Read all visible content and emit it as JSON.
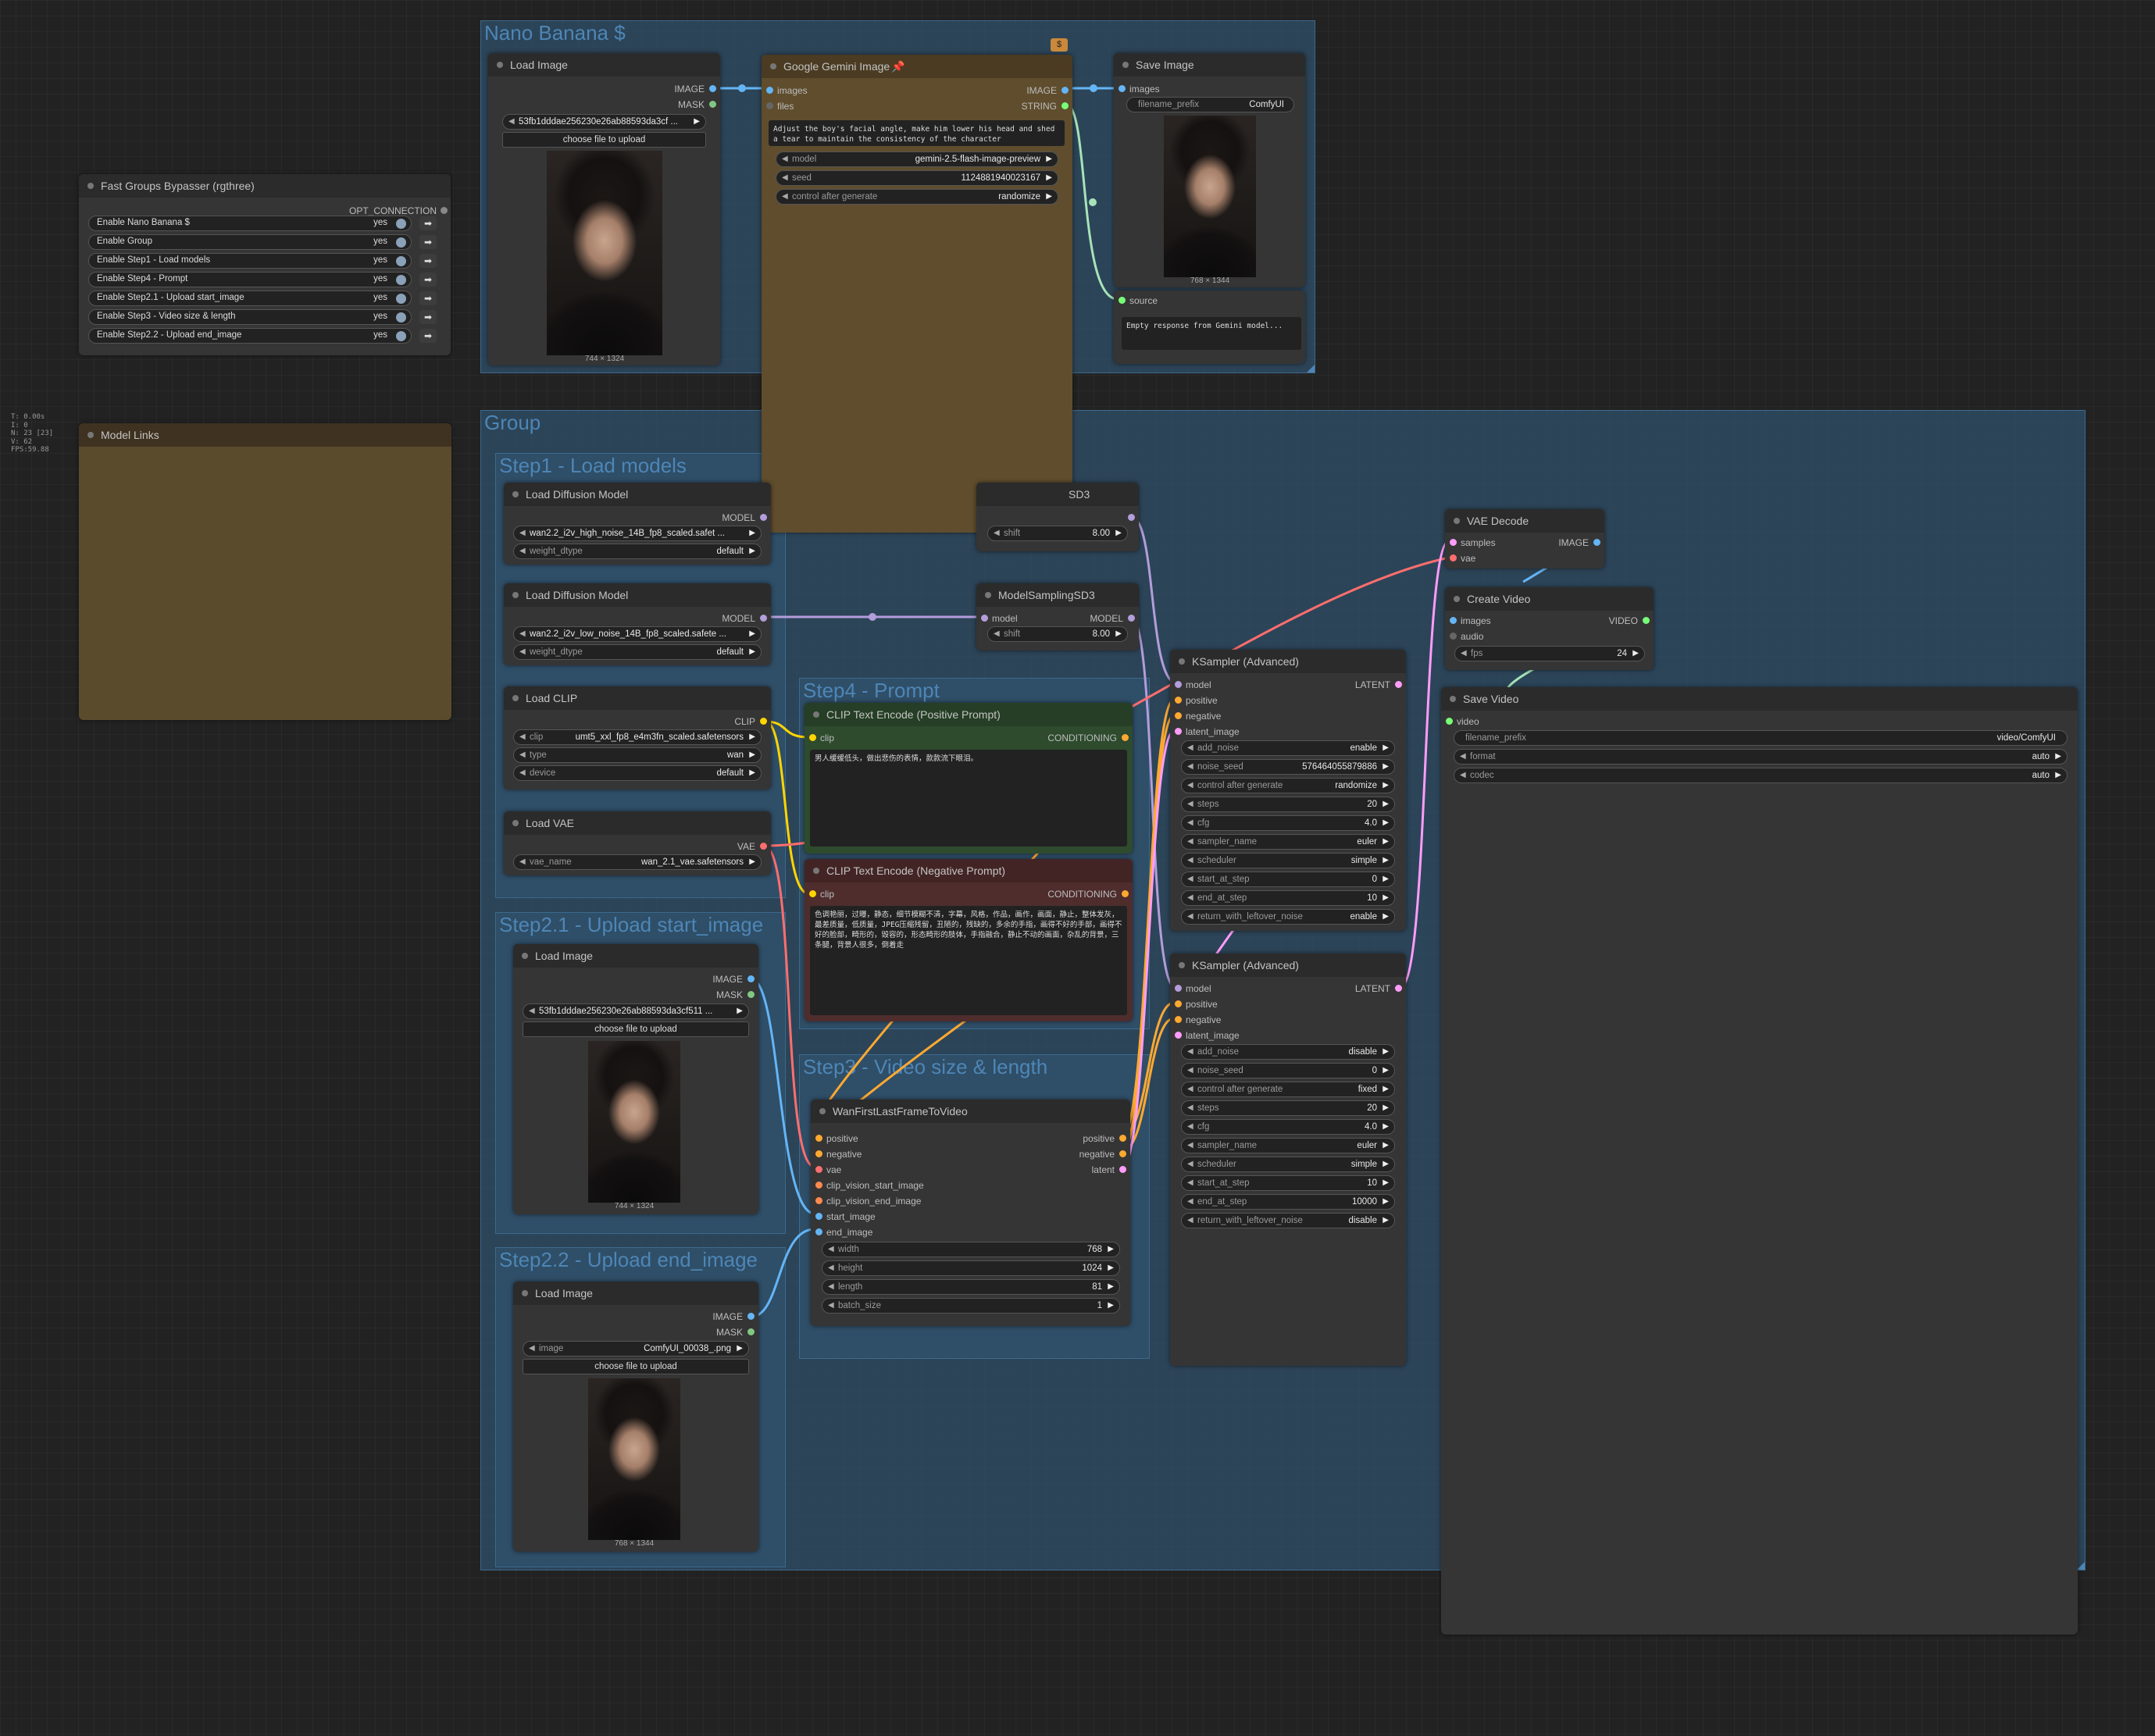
{
  "stats": [
    "T: 0.00s",
    "I: 0",
    "N: 23 [23]",
    "V: 62",
    "FPS:59.88"
  ],
  "groups": {
    "nano": "Nano Banana $",
    "main": "Group",
    "step1": "Step1 - Load models",
    "step4": "Step4 - Prompt",
    "step21": "Step2.1 - Upload start_image",
    "step3": "Step3 - Video size & length",
    "step22": "Step2.2 - Upload end_image"
  },
  "bypasser": {
    "title": "Fast Groups Bypasser (rgthree)",
    "output": "OPT_CONNECTION",
    "rows": [
      {
        "label": "Enable Nano Banana $",
        "value": "yes"
      },
      {
        "label": "Enable Group",
        "value": "yes"
      },
      {
        "label": "Enable Step1 - Load models",
        "value": "yes"
      },
      {
        "label": "Enable Step4 - Prompt",
        "value": "yes"
      },
      {
        "label": "Enable Step2.1 - Upload start_image",
        "value": "yes"
      },
      {
        "label": "Enable Step3 - Video size & length",
        "value": "yes"
      },
      {
        "label": "Enable Step2.2 - Upload end_image",
        "value": "yes"
      }
    ]
  },
  "model_links": {
    "title": "Model Links"
  },
  "nano_load": {
    "title": "Load Image",
    "out_image": "IMAGE",
    "out_mask": "MASK",
    "image": "53fb1dddae256230e26ab88593da3cf ...",
    "upload": "choose file to upload",
    "caption": "744 × 1324"
  },
  "gemini": {
    "title": "Google Gemini Image",
    "in_images": "images",
    "in_files": "files",
    "out_image": "IMAGE",
    "out_string": "STRING",
    "prompt": "Adjust the boy's facial angle, make him lower his head and shed a tear to maintain the consistency of the character",
    "model_label": "model",
    "model_value": "gemini-2.5-flash-image-preview",
    "seed_label": "seed",
    "seed_value": "1124881940023167",
    "cag_label": "control after generate",
    "cag_value": "randomize",
    "badge": "$"
  },
  "save_image": {
    "title": "Save Image",
    "in_images": "images",
    "prefix_label": "filename_prefix",
    "prefix_value": "ComfyUI",
    "caption": "768 × 1344"
  },
  "preview_text": {
    "in_source": "source",
    "text": "Empty response from Gemini model..."
  },
  "load_diff_1": {
    "title": "Load Diffusion Model",
    "out": "MODEL",
    "unet": "wan2.2_i2v_high_noise_14B_fp8_scaled.safet ...",
    "dtype_label": "weight_dtype",
    "dtype_value": "default"
  },
  "load_diff_2": {
    "title": "Load Diffusion Model",
    "out": "MODEL",
    "unet": "wan2.2_i2v_low_noise_14B_fp8_scaled.safete ...",
    "dtype_label": "weight_dtype",
    "dtype_value": "default"
  },
  "load_clip": {
    "title": "Load CLIP",
    "out": "CLIP",
    "clip_label": "clip",
    "clip_value": "umt5_xxl_fp8_e4m3fn_scaled.safetensors",
    "type_label": "type",
    "type_value": "wan",
    "device_label": "device",
    "device_value": "default"
  },
  "load_vae": {
    "title": "Load VAE",
    "out": "VAE",
    "name_label": "vae_name",
    "name_value": "wan_2.1_vae.safetensors"
  },
  "msd3_1": {
    "title_visible": "SD3",
    "shift_label": "shift",
    "shift_value": "8.00",
    "out": "MODEL"
  },
  "msd3_2": {
    "title": "ModelSamplingSD3",
    "in": "model",
    "out": "MODEL",
    "shift_label": "shift",
    "shift_value": "8.00"
  },
  "clip_pos": {
    "title": "CLIP Text Encode (Positive Prompt)",
    "in": "clip",
    "out": "CONDITIONING",
    "text": "男人缓缓低头，做出悲伤的表情，款款流下眼泪。"
  },
  "clip_neg": {
    "title": "CLIP Text Encode (Negative Prompt)",
    "in": "clip",
    "out": "CONDITIONING",
    "text": "色调艳丽，过曝，静态，细节模糊不清，字幕，风格，作品，画作，画面，静止，整体发灰，最差质量，低质量，JPEG压缩残留，丑陋的，残缺的，多余的手指，画得不好的手部，画得不好的脸部，畸形的，毁容的，形态畸形的肢体，手指融合，静止不动的画面，杂乱的背景，三条腿，背景人很多，倒着走"
  },
  "start_load": {
    "title": "Load Image",
    "out_image": "IMAGE",
    "out_mask": "MASK",
    "image": "53fb1dddae256230e26ab88593da3cf511 ...",
    "upload": "choose file to upload",
    "caption": "744 × 1324"
  },
  "end_load": {
    "title": "Load Image",
    "out_image": "IMAGE",
    "out_mask": "MASK",
    "image_label": "image",
    "image_value": "ComfyUI_00038_.png",
    "upload": "choose file to upload",
    "caption": "768 × 1344"
  },
  "wan": {
    "title": "WanFirstLastFrameToVideo",
    "inputs": [
      "positive",
      "negative",
      "vae",
      "clip_vision_start_image",
      "clip_vision_end_image",
      "start_image",
      "end_image"
    ],
    "outputs": [
      "positive",
      "negative",
      "latent"
    ],
    "widgets": [
      {
        "label": "width",
        "value": "768"
      },
      {
        "label": "height",
        "value": "1024"
      },
      {
        "label": "length",
        "value": "81"
      },
      {
        "label": "batch_size",
        "value": "1"
      }
    ]
  },
  "ks1": {
    "title": "KSampler (Advanced)",
    "inputs": [
      "model",
      "positive",
      "negative",
      "latent_image"
    ],
    "out": "LATENT",
    "widgets": [
      {
        "label": "add_noise",
        "value": "enable"
      },
      {
        "label": "noise_seed",
        "value": "576464055879886"
      },
      {
        "label": "control after generate",
        "value": "randomize"
      },
      {
        "label": "steps",
        "value": "20"
      },
      {
        "label": "cfg",
        "value": "4.0"
      },
      {
        "label": "sampler_name",
        "value": "euler"
      },
      {
        "label": "scheduler",
        "value": "simple"
      },
      {
        "label": "start_at_step",
        "value": "0"
      },
      {
        "label": "end_at_step",
        "value": "10"
      },
      {
        "label": "return_with_leftover_noise",
        "value": "enable"
      }
    ]
  },
  "ks2": {
    "title": "KSampler (Advanced)",
    "inputs": [
      "model",
      "positive",
      "negative",
      "latent_image"
    ],
    "out": "LATENT",
    "widgets": [
      {
        "label": "add_noise",
        "value": "disable"
      },
      {
        "label": "noise_seed",
        "value": "0"
      },
      {
        "label": "control after generate",
        "value": "fixed"
      },
      {
        "label": "steps",
        "value": "20"
      },
      {
        "label": "cfg",
        "value": "4.0"
      },
      {
        "label": "sampler_name",
        "value": "euler"
      },
      {
        "label": "scheduler",
        "value": "simple"
      },
      {
        "label": "start_at_step",
        "value": "10"
      },
      {
        "label": "end_at_step",
        "value": "10000"
      },
      {
        "label": "return_with_leftover_noise",
        "value": "disable"
      }
    ]
  },
  "vae_decode": {
    "title": "VAE Decode",
    "in_samples": "samples",
    "in_vae": "vae",
    "out": "IMAGE"
  },
  "create_video": {
    "title": "Create Video",
    "in_images": "images",
    "in_audio": "audio",
    "out": "VIDEO",
    "fps_label": "fps",
    "fps_value": "24"
  },
  "save_video": {
    "title": "Save Video",
    "in_video": "video",
    "prefix_label": "filename_prefix",
    "prefix_value": "video/ComfyUI",
    "format_label": "format",
    "format_value": "auto",
    "codec_label": "codec",
    "codec_value": "auto"
  },
  "colors": {
    "image": "#64b5f6",
    "mask": "#81c784",
    "model": "#b39ddb",
    "clip": "#ffd500",
    "vae": "#ff6e6e",
    "conditioning": "#ffa931",
    "latent": "#ff9cf9",
    "string": "#77ff77"
  }
}
